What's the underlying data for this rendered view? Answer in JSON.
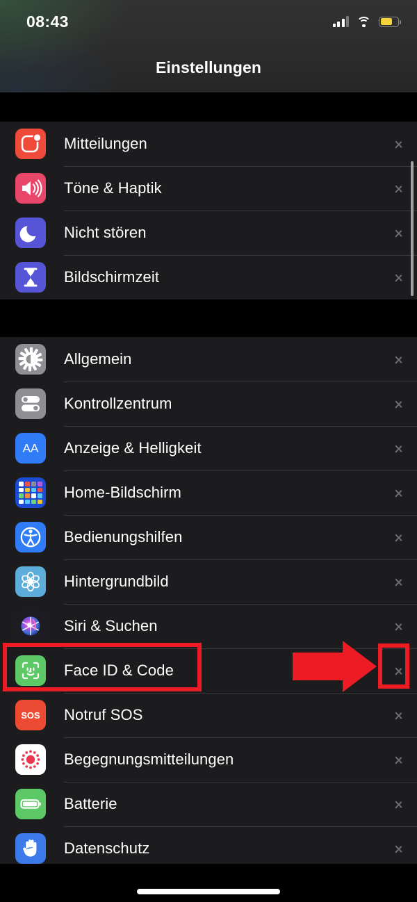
{
  "device": {
    "status_bar": {
      "time": "08:43",
      "signal_icon": "cellular-signal-icon",
      "signal_bars_filled": 3,
      "signal_bars_total": 4,
      "wifi_icon": "wifi-icon",
      "battery_icon": "battery-icon",
      "battery_color": "#f5d33a",
      "battery_level_percent": 70,
      "low_power_mode": true
    },
    "home_indicator": "home-indicator"
  },
  "header": {
    "title": "Einstellungen"
  },
  "sections": [
    {
      "id": "notifications-group",
      "rows": [
        {
          "label": "Mitteilungen",
          "icon": "notifications-icon",
          "color": "#ee4b3a",
          "chevron": "chevron-right-icon"
        },
        {
          "label": "Töne & Haptik",
          "icon": "sounds-haptics-icon",
          "color": "#e8476a",
          "chevron": "chevron-right-icon"
        },
        {
          "label": "Nicht stören",
          "icon": "do-not-disturb-icon",
          "color": "#5655d8",
          "chevron": "chevron-right-icon"
        },
        {
          "label": "Bildschirmzeit",
          "icon": "screen-time-icon",
          "color": "#5655d8",
          "chevron": "chevron-right-icon"
        }
      ]
    },
    {
      "id": "system-group",
      "rows": [
        {
          "label": "Allgemein",
          "icon": "gear-icon",
          "color": "#8e8e93",
          "chevron": "chevron-right-icon"
        },
        {
          "label": "Kontrollzentrum",
          "icon": "control-center-icon",
          "color": "#8e8e93",
          "chevron": "chevron-right-icon"
        },
        {
          "label": "Anzeige & Helligkeit",
          "icon": "display-brightness-icon",
          "color": "#2f7cf6",
          "chevron": "chevron-right-icon"
        },
        {
          "label": "Home-Bildschirm",
          "icon": "home-screen-icon",
          "color": "#1c4bd4",
          "chevron": "chevron-right-icon"
        },
        {
          "label": "Bedienungshilfen",
          "icon": "accessibility-icon",
          "color": "#2f7cf6",
          "chevron": "chevron-right-icon"
        },
        {
          "label": "Hintergrundbild",
          "icon": "wallpaper-icon",
          "color": "#5cadd9",
          "chevron": "chevron-right-icon"
        },
        {
          "label": "Siri & Suchen",
          "icon": "siri-icon",
          "color": "#1c1c22",
          "chevron": "chevron-right-icon"
        },
        {
          "label": "Face ID & Code",
          "icon": "face-id-icon",
          "color": "#5cc966",
          "chevron": "chevron-right-icon"
        },
        {
          "label": "Notruf SOS",
          "icon": "emergency-sos-icon",
          "color": "#ec4a33",
          "chevron": "chevron-right-icon"
        },
        {
          "label": "Begegnungsmitteilungen",
          "icon": "exposure-notifications-icon",
          "color": "#ffffff",
          "chevron": "chevron-right-icon"
        },
        {
          "label": "Batterie",
          "icon": "battery-settings-icon",
          "color": "#5cc966",
          "chevron": "chevron-right-icon"
        },
        {
          "label": "Datenschutz",
          "icon": "privacy-icon",
          "color": "#3b7ae8",
          "chevron": "chevron-right-icon"
        }
      ]
    }
  ],
  "annotations": {
    "highlight_color": "#ed1c24",
    "target_row_label": "Face ID & Code",
    "label_box": "red-highlight-box-face-id-row",
    "chevron_box": "red-highlight-box-chevron",
    "arrow": "red-arrow-pointing-right"
  },
  "scrollbar": {
    "name": "vertical-scrollbar"
  }
}
